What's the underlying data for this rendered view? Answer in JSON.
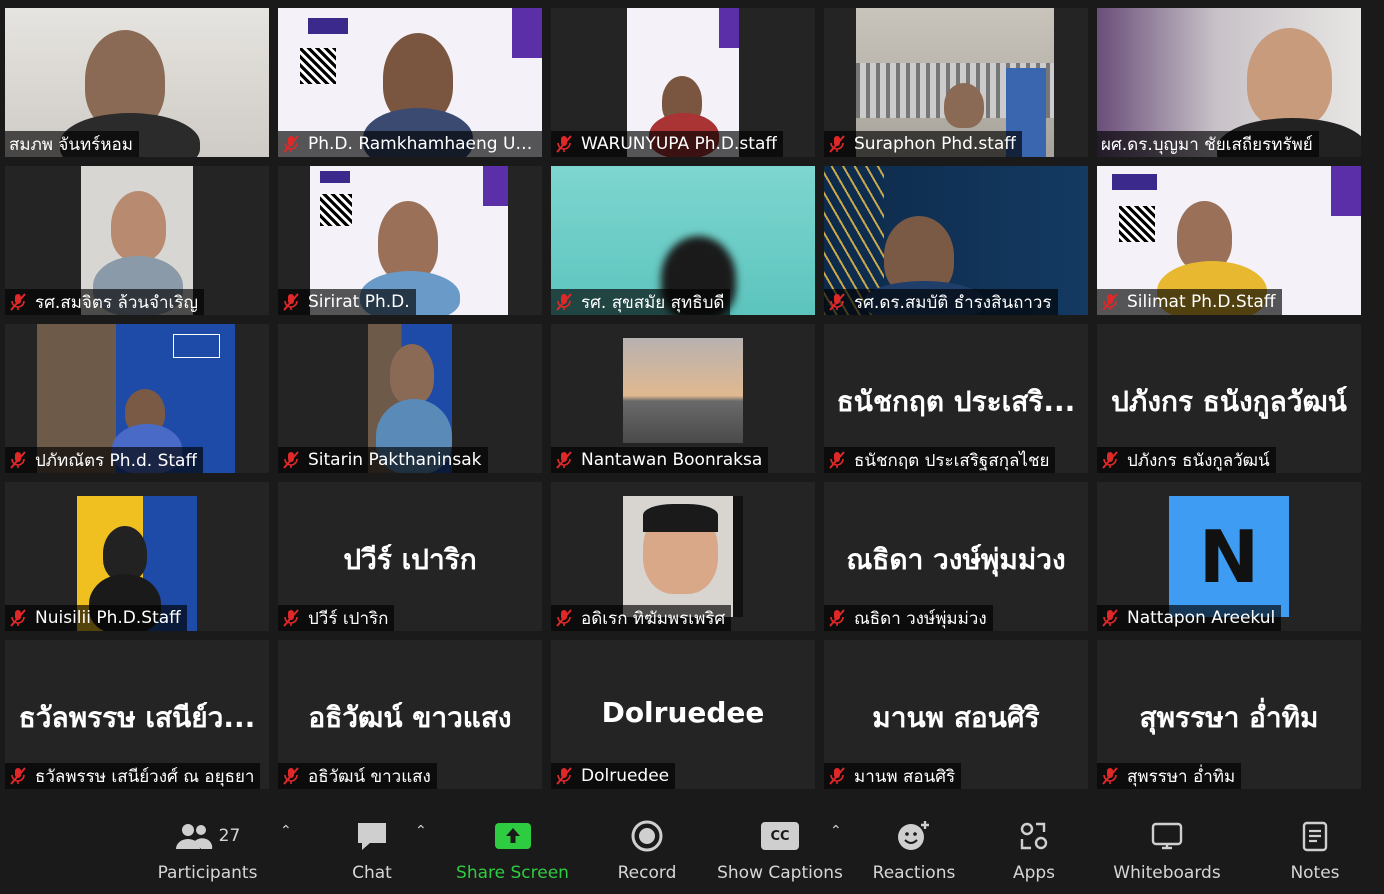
{
  "participants": [
    {
      "label": "สมภพ จันทร์หอม",
      "muted": false
    },
    {
      "label": "Ph.D. Ramkhamhaeng Un...",
      "muted": true
    },
    {
      "label": "WARUNYUPA Ph.D.staff",
      "muted": true
    },
    {
      "label": "Suraphon Phd.staff",
      "muted": true
    },
    {
      "label": "ผศ.ดร.บุญมา ชัยเสถียรทรัพย์",
      "muted": false
    },
    {
      "label": "รศ.สมจิตร ล้วนจำเริญ",
      "muted": true
    },
    {
      "label": "Sirirat Ph.D.",
      "muted": true
    },
    {
      "label": "รศ. สุขสมัย สุทธิบดี",
      "muted": true
    },
    {
      "label": "รศ.ดร.สมบัติ ธำรงสินถาวร",
      "muted": true
    },
    {
      "label": "Silimat Ph.D.Staff",
      "muted": true
    },
    {
      "label": "ปภัทณัตร Ph.d. Staff",
      "muted": true
    },
    {
      "label": "Sitarin Pakthaninsak",
      "muted": true
    },
    {
      "label": "Nantawan Boonraksa",
      "muted": true
    },
    {
      "label": "ธนัชกฤต ประเสริฐสกุลไชย",
      "muted": true,
      "display": "ธนัชกฤต ประเสริ..."
    },
    {
      "label": "ปภังกร ธนังกูลวัฒน์",
      "muted": true,
      "display": "ปภังกร ธนังกูลวัฒน์"
    },
    {
      "label": "Nuisilii Ph.D.Staff",
      "muted": true
    },
    {
      "label": "ปวีร์ เปาริก",
      "muted": true,
      "display": "ปวีร์ เปาริก"
    },
    {
      "label": "อดิเรก ทิฆัมพรเพริศ",
      "muted": true
    },
    {
      "label": "ณธิดา วงษ์พุ่มม่วง",
      "muted": true,
      "display": "ณธิดา วงษ์พุ่มม่วง"
    },
    {
      "label": "Nattapon Areekul",
      "muted": true,
      "avatar_letter": "N"
    },
    {
      "label": "ธวัลพรรษ เสนีย์วงศ์ ณ อยุธยา",
      "muted": true,
      "display": "ธวัลพรรษ เสนีย์ว..."
    },
    {
      "label": "อธิวัฒน์ ขาวแสง",
      "muted": true,
      "display": "อธิวัฒน์ ขาวแสง"
    },
    {
      "label": "Dolruedee",
      "muted": true,
      "display": "Dolruedee"
    },
    {
      "label": "มานพ สอนศิริ",
      "muted": true,
      "display": "มานพ สอนศิริ"
    },
    {
      "label": "สุพรรษา อ่ำทิม",
      "muted": true,
      "display": "สุพรรษา อ่ำทิม"
    }
  ],
  "toolbar": {
    "participants_label": "Participants",
    "participants_count": "27",
    "chat_label": "Chat",
    "share_label": "Share Screen",
    "record_label": "Record",
    "captions_label": "Show Captions",
    "captions_icon_text": "CC",
    "reactions_label": "Reactions",
    "apps_label": "Apps",
    "whiteboards_label": "Whiteboards",
    "notes_label": "Notes"
  },
  "colors": {
    "share_green": "#2ecc40",
    "mute_red": "#e02828",
    "tile_bg": "#242424",
    "avatar_blue": "#3e9cf2"
  }
}
